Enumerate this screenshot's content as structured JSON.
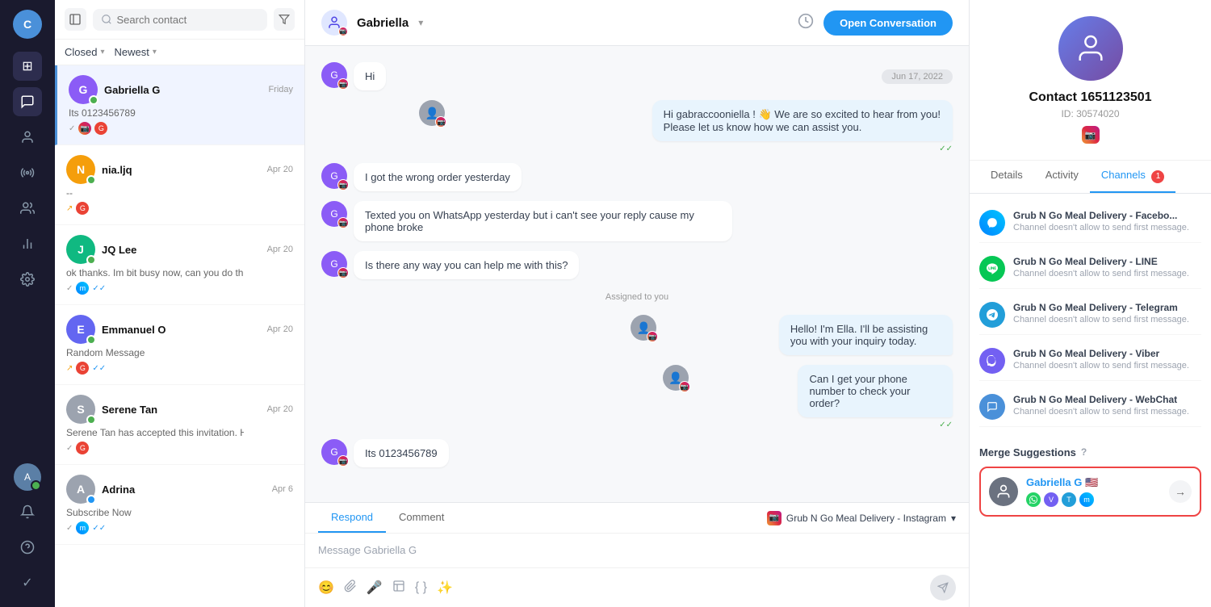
{
  "nav": {
    "user_initial": "C",
    "icons": [
      {
        "name": "layout-icon",
        "symbol": "⊞",
        "active": false
      },
      {
        "name": "chat-icon",
        "symbol": "💬",
        "active": true
      },
      {
        "name": "contacts-icon",
        "symbol": "👤",
        "active": false
      },
      {
        "name": "broadcast-icon",
        "symbol": "📡",
        "active": false
      },
      {
        "name": "team-icon",
        "symbol": "⊛",
        "active": false
      },
      {
        "name": "reports-icon",
        "symbol": "📊",
        "active": false
      },
      {
        "name": "settings-icon",
        "symbol": "⚙",
        "active": false
      }
    ],
    "bottom_icons": [
      {
        "name": "user-bottom-icon",
        "symbol": "👤"
      },
      {
        "name": "bell-icon",
        "symbol": "🔔"
      },
      {
        "name": "help-icon",
        "symbol": "?"
      },
      {
        "name": "check-icon",
        "symbol": "✓"
      }
    ]
  },
  "conv_panel": {
    "search_placeholder": "Search contact",
    "filter_label": "Closed",
    "sort_label": "Newest",
    "conversations": [
      {
        "id": "1",
        "name": "Gabriella G",
        "time": "Friday",
        "preview": "Its 0123456789",
        "avatar_color": "#8b5cf6",
        "initial": "G",
        "active": true,
        "tags": [
          "instagram",
          "gmail"
        ]
      },
      {
        "id": "2",
        "name": "nia.ljq",
        "time": "Apr 20",
        "preview": "--",
        "avatar_color": "#f59e0b",
        "initial": "N",
        "active": false,
        "tags": [
          "gmail"
        ],
        "arrow": true
      },
      {
        "id": "3",
        "name": "JQ Lee",
        "time": "Apr 20",
        "preview": "ok thanks. Im bit busy now, can you do the simple sign up for me...",
        "avatar_color": "#10b981",
        "initial": "J",
        "active": false,
        "tags": [
          "messenger"
        ],
        "check": true,
        "check_blue": true
      },
      {
        "id": "4",
        "name": "Emmanuel O",
        "time": "Apr 20",
        "preview": "Random Message",
        "avatar_color": "#6366f1",
        "initial": "E",
        "active": false,
        "tags": [
          "gmail"
        ],
        "arrow": true,
        "check": true,
        "check_blue": true
      },
      {
        "id": "5",
        "name": "Serene Tan",
        "time": "Apr 20",
        "preview": "Serene Tan has accepted this invitation. HOW TO GET WHATSAPP...",
        "avatar_color": "#9ca3af",
        "initial": "S",
        "active": false,
        "tags": [
          "gmail"
        ],
        "check": true
      },
      {
        "id": "6",
        "name": "Adrina",
        "time": "Apr 6",
        "preview": "Subscribe Now",
        "avatar_color": "#9ca3af",
        "initial": "A",
        "active": false,
        "tags": [
          "messenger"
        ],
        "check": true,
        "check_blue": true
      }
    ]
  },
  "chat": {
    "contact_name": "Gabriella",
    "open_btn_label": "Open Conversation",
    "date_label": "Jun 17, 2022",
    "messages": [
      {
        "id": "m1",
        "type": "inbound",
        "text": "Hi",
        "sender": "G",
        "sender_color": "#8b5cf6"
      },
      {
        "id": "m2",
        "type": "outbound",
        "text": "Hi gabraccooniella ! 👋 We are so excited to hear from you! Please let us know how we can assist you.",
        "has_check": true
      },
      {
        "id": "m3",
        "type": "inbound",
        "text": "I got the wrong order yesterday",
        "sender": "G",
        "sender_color": "#8b5cf6"
      },
      {
        "id": "m4",
        "type": "inbound",
        "text": "Texted you on WhatsApp yesterday but i can't see your reply cause my phone broke",
        "sender": "G",
        "sender_color": "#8b5cf6"
      },
      {
        "id": "m5",
        "type": "inbound",
        "text": "Is there any way you can help me with this?",
        "sender": "G",
        "sender_color": "#8b5cf6"
      },
      {
        "id": "m6",
        "type": "assigned",
        "text": "Assigned to you"
      },
      {
        "id": "m7",
        "type": "outbound",
        "text": "Hello! I'm Ella. I'll be assisting you with your inquiry today."
      },
      {
        "id": "m8",
        "type": "outbound",
        "text": "Can I get your phone number to check your order?",
        "has_check": true
      },
      {
        "id": "m9",
        "type": "inbound",
        "text": "Its 0123456789",
        "sender": "G",
        "sender_color": "#8b5cf6"
      }
    ],
    "input_placeholder": "Message Gabriella G",
    "tabs": [
      {
        "label": "Respond",
        "active": true
      },
      {
        "label": "Comment",
        "active": false
      }
    ],
    "channel_label": "Grub N Go Meal Delivery - Instagram"
  },
  "right_panel": {
    "contact_name": "Contact 1651123501",
    "contact_id": "ID: 30574020",
    "tabs": [
      {
        "label": "Details",
        "active": false
      },
      {
        "label": "Activity",
        "active": false
      },
      {
        "label": "Channels",
        "active": true,
        "badge": "1"
      }
    ],
    "channels": [
      {
        "name": "Grub N Go Meal Delivery - Facebo...",
        "desc": "Channel doesn't allow to send first message.",
        "type": "messenger"
      },
      {
        "name": "Grub N Go Meal Delivery - LINE",
        "desc": "Channel doesn't allow to send first message.",
        "type": "line"
      },
      {
        "name": "Grub N Go Meal Delivery - Telegram",
        "desc": "Channel doesn't allow to send first message.",
        "type": "telegram"
      },
      {
        "name": "Grub N Go Meal Delivery - Viber",
        "desc": "Channel doesn't allow to send first message.",
        "type": "viber"
      },
      {
        "name": "Grub N Go Meal Delivery - WebChat",
        "desc": "Channel doesn't allow to send first message.",
        "type": "webchat"
      }
    ],
    "merge_section_label": "Merge Suggestions",
    "merge_contact": {
      "name": "Gabriella G 🇺🇸",
      "channels": [
        "whatsapp",
        "viber",
        "telegram",
        "messenger"
      ]
    }
  }
}
